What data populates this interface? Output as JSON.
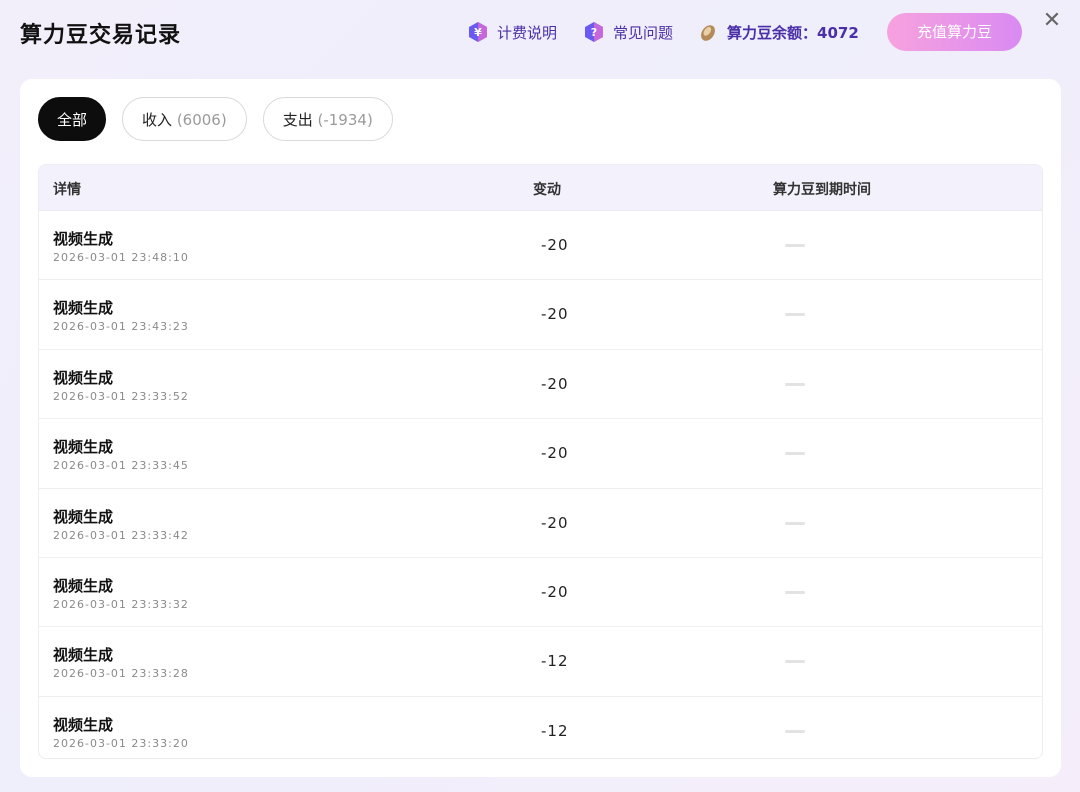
{
  "title": "算力豆交易记录",
  "header": {
    "billing_label": "计费说明",
    "faq_label": "常见问题",
    "balance_label": "算力豆余额：",
    "balance_value": "4072",
    "recharge_label": "充值算力豆",
    "close_glyph": "✕"
  },
  "tabs": [
    {
      "label": "全部",
      "count": ""
    },
    {
      "label": "收入",
      "count": "(6006)"
    },
    {
      "label": "支出",
      "count": "(-1934)"
    }
  ],
  "table": {
    "headers": {
      "detail": "详情",
      "change": "变动",
      "expire": "算力豆到期时间"
    },
    "rows": [
      {
        "name": "视频生成",
        "time": "2026-03-01 23:48:10",
        "change": "-20"
      },
      {
        "name": "视频生成",
        "time": "2026-03-01 23:43:23",
        "change": "-20"
      },
      {
        "name": "视频生成",
        "time": "2026-03-01 23:33:52",
        "change": "-20"
      },
      {
        "name": "视频生成",
        "time": "2026-03-01 23:33:45",
        "change": "-20"
      },
      {
        "name": "视频生成",
        "time": "2026-03-01 23:33:42",
        "change": "-20"
      },
      {
        "name": "视频生成",
        "time": "2026-03-01 23:33:32",
        "change": "-20"
      },
      {
        "name": "视频生成",
        "time": "2026-03-01 23:33:28",
        "change": "-12"
      },
      {
        "name": "视频生成",
        "time": "2026-03-01 23:33:20",
        "change": "-12"
      }
    ]
  },
  "colors": {
    "accent": "#4a2fa8",
    "recharge_start": "#f7a2de",
    "recharge_end": "#d98af2"
  }
}
